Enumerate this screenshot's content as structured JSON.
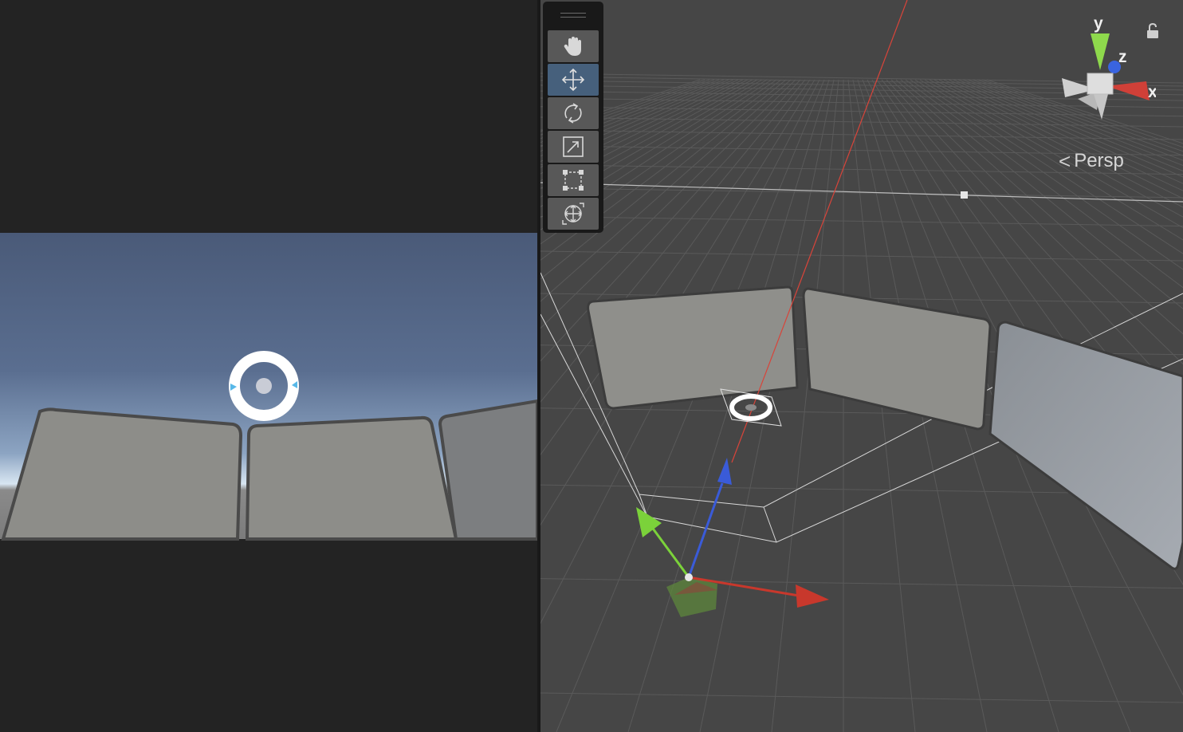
{
  "scene_view": {
    "camera_mode_label": "Persp",
    "gizmo_axes": {
      "x": "x",
      "y": "y",
      "z": "z"
    }
  },
  "toolbar": {
    "tools": [
      {
        "name": "hand-tool",
        "icon": "hand-icon",
        "active": false
      },
      {
        "name": "move-tool",
        "icon": "move-icon",
        "active": true
      },
      {
        "name": "rotate-tool",
        "icon": "rotate-icon",
        "active": false
      },
      {
        "name": "scale-tool",
        "icon": "scale-icon",
        "active": false
      },
      {
        "name": "rect-tool",
        "icon": "rect-transform-icon",
        "active": false
      },
      {
        "name": "transform-tool",
        "icon": "transform-icon",
        "active": false
      }
    ]
  },
  "colors": {
    "x_axis": "#c8382c",
    "y_axis": "#7bd23a",
    "z_axis": "#3a5bd8",
    "active_tool": "#46607c",
    "scene_background": "#464646",
    "game_background": "#232323"
  }
}
